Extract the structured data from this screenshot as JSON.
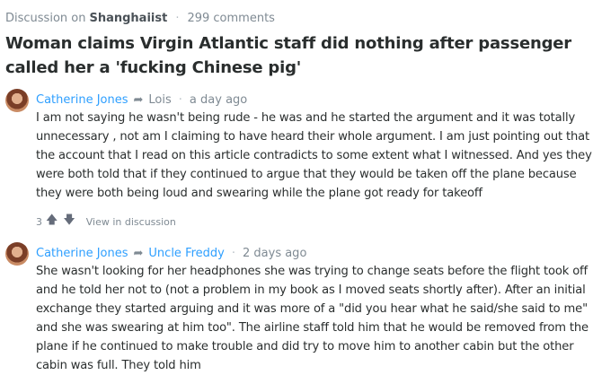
{
  "header": {
    "prefix": "Discussion on",
    "site": "Shanghaiist",
    "dot": "·",
    "comments_count": "299 comments"
  },
  "title": "Woman claims Virgin Atlantic staff did nothing after passenger called her a 'fucking Chinese pig'",
  "comments": [
    {
      "author": "Catherine Jones",
      "reply_to": "Lois",
      "time": "a day ago",
      "text": "I am not saying he wasn't being rude - he was and he started the argument and it was totally unnecessary , not am I claiming to have heard their whole argument. I am just pointing out that the account that I read on this article contradicts to some extent what I witnessed. And yes they were both told that if they continued to argue that they would be taken off the plane because they were both being loud and swearing while the plane got ready for takeoff",
      "votes": "3",
      "view_label": "View in discussion"
    },
    {
      "author": "Catherine Jones",
      "reply_to": "Uncle Freddy",
      "time": "2 days ago",
      "text": "She wasn't looking for her headphones she was trying to change seats before the flight took off and he told her not to (not a problem in my book as I moved seats shortly after). After an initial exchange they started arguing and it was more of a \"did you hear what he said/she said to me\" and she was swearing at him too\". The airline staff told him that he would be removed from the plane if he continued to make trouble and did try to move him to another cabin but the other cabin was full. They told him"
    }
  ],
  "icons": {
    "reply_arrow": "➦",
    "upvote": "🡅",
    "downvote": "🡇"
  },
  "colors": {
    "link": "#2e9fff",
    "muted": "#7f8a93",
    "text": "#2a2e2e"
  }
}
